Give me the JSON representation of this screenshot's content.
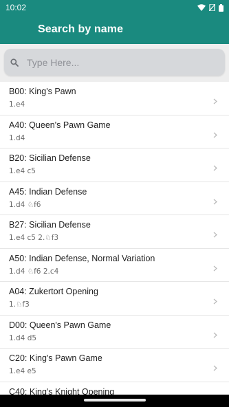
{
  "status": {
    "time": "10:02"
  },
  "toolbar": {
    "title": "Search by name"
  },
  "search": {
    "placeholder": "Type Here...",
    "value": ""
  },
  "openings": [
    {
      "name": "B00: King's Pawn",
      "moves": "1.e4"
    },
    {
      "name": "A40: Queen's Pawn Game",
      "moves": "1.d4"
    },
    {
      "name": "B20: Sicilian Defense",
      "moves": "1.e4 c5"
    },
    {
      "name": "A45: Indian Defense",
      "moves": "1.d4 ♘f6"
    },
    {
      "name": "B27: Sicilian Defense",
      "moves": "1.e4 c5 2.♘f3"
    },
    {
      "name": "A50: Indian Defense, Normal Variation",
      "moves": "1.d4 ♘f6 2.c4"
    },
    {
      "name": "A04: Zukertort Opening",
      "moves": "1.♘f3"
    },
    {
      "name": "D00: Queen's Pawn Game",
      "moves": "1.d4 d5"
    },
    {
      "name": "C20: King's Pawn Game",
      "moves": "1.e4 e5"
    },
    {
      "name": "C40: King's Knight Opening",
      "moves": ""
    }
  ],
  "colors": {
    "appbar": "#1a8a7f",
    "search_bar": "#eeeeee",
    "search_box": "#d6d8db"
  },
  "icons": {
    "search": "search-icon",
    "chevron": "chevron-right-icon",
    "wifi": "wifi-icon",
    "battery": "battery-icon"
  }
}
